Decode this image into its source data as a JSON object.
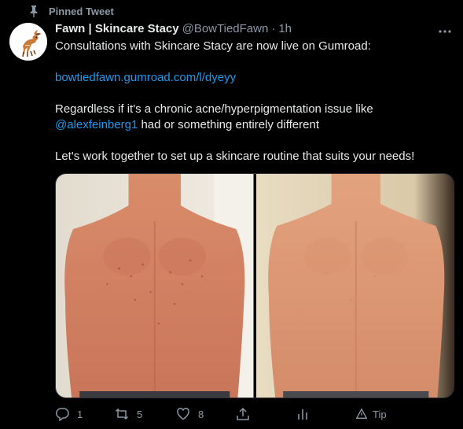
{
  "pinned_label": "Pinned Tweet",
  "tweet": {
    "name": "Fawn | Skincare Stacy",
    "handle": "@BowTiedFawn",
    "separator": "·",
    "time": "1h",
    "text_line1": "Consultations with Skincare Stacy are now live on Gumroad:",
    "link": "bowtiedfawn.gumroad.com/l/dyeyy",
    "text_line3a": "Regardless if it's a chronic acne/hyperpigmentation issue like",
    "mention": "@alexfeinberg1",
    "text_line3b": " had or something entirely different",
    "text_line4": "Let's work together to set up a skincare routine that suits your needs!"
  },
  "actions": {
    "reply_count": "1",
    "retweet_count": "5",
    "like_count": "8",
    "tip_label": "Tip"
  },
  "icons": {
    "pin": "pin-icon",
    "more": "more-icon",
    "reply": "reply-icon",
    "retweet": "retweet-icon",
    "like": "heart-icon",
    "share": "share-icon",
    "analytics": "analytics-icon",
    "tip": "tip-icon"
  },
  "colors": {
    "background": "#000000",
    "text": "#e7e9ea",
    "secondary": "#8b98a5",
    "link": "#1d9bf0"
  }
}
